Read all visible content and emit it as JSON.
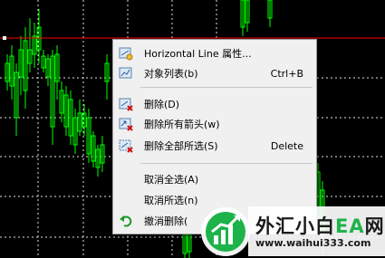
{
  "colors": {
    "background": "#000000",
    "grid": "#e0e0e0",
    "candle": "#00ff00",
    "horizontal_line": "#ff0000",
    "menu_bg": "#f0f0f0",
    "watermark_green": "#1db34a",
    "watermark_accent": "#e63a2e"
  },
  "context_menu": {
    "items": [
      {
        "label": "Horizontal Line 属性...",
        "shortcut": "",
        "icon": "line-properties-icon"
      },
      {
        "label": "对象列表(b)",
        "shortcut": "Ctrl+B",
        "icon": "object-list-icon"
      },
      {
        "label": "删除(D)",
        "shortcut": "",
        "icon": "delete-icon"
      },
      {
        "label": "删除所有箭头(w)",
        "shortcut": "",
        "icon": "delete-arrows-icon"
      },
      {
        "label": "删除全部所选(S)",
        "shortcut": "Delete",
        "icon": "delete-selected-icon"
      },
      {
        "label": "取消全选(A)",
        "shortcut": "",
        "icon": ""
      },
      {
        "label": "取消所选(n)",
        "shortcut": "",
        "icon": ""
      },
      {
        "label": "撤消删除(",
        "shortcut": "",
        "icon": "undo-icon"
      }
    ]
  },
  "watermark": {
    "name_part1": "外汇小白",
    "name_part2": "EA",
    "name_part3": "网",
    "url": "www.waihui333.com"
  }
}
